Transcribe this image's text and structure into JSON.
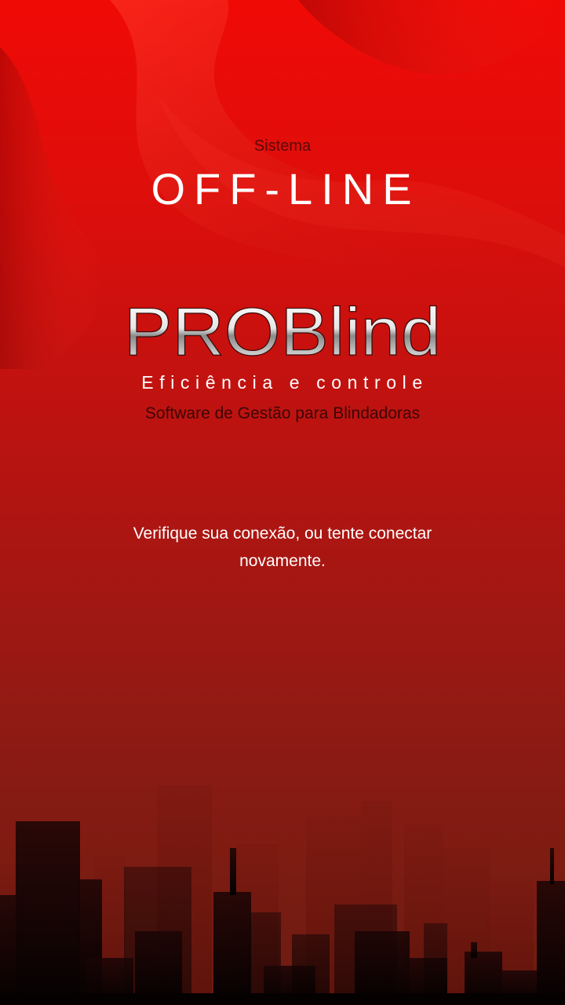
{
  "header": {
    "label": "Sistema",
    "status": "OFF-LINE"
  },
  "brand": {
    "logo_text": "PROBlind",
    "tagline": "Eficiência e controle",
    "subtitle": "Software de Gestão para Blindadoras"
  },
  "message": {
    "text": "Verifique sua conexão, ou tente conectar novamente."
  },
  "colors": {
    "background_top": "#f00a06",
    "background_bottom": "#6a1b10",
    "status_text": "#ffffff",
    "skyline": "#0c0303"
  }
}
